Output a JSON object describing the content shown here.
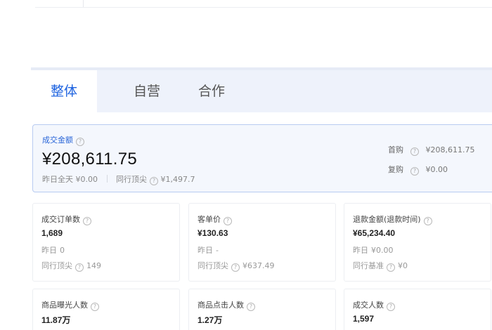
{
  "tabs": [
    {
      "label": "整体",
      "active": true
    },
    {
      "label": "自营",
      "active": false
    },
    {
      "label": "合作",
      "active": false
    }
  ],
  "hero": {
    "label": "成交金额",
    "value": "¥208,611.75",
    "yesterday_label": "昨日全天",
    "yesterday_value": "¥0.00",
    "peer_label": "同行顶尖",
    "peer_value": "¥1,497.7",
    "first_purchase_label": "首购",
    "first_purchase_value": "¥208,611.75",
    "repeat_purchase_label": "复购",
    "repeat_purchase_value": "¥0.00"
  },
  "cards": [
    {
      "title": "成交订单数",
      "value": "1,689",
      "line2_label": "昨日",
      "line2_value": "0",
      "line3_label": "同行顶尖",
      "line3_value": "149"
    },
    {
      "title": "客单价",
      "value": "¥130.63",
      "line2_label": "昨日",
      "line2_value": "-",
      "line3_label": "同行顶尖",
      "line3_value": "¥637.49"
    },
    {
      "title": "退款金额(退款时间)",
      "value": "¥65,234.40",
      "line2_label": "昨日",
      "line2_value": "¥0.00",
      "line3_label": "同行基准",
      "line3_value": "¥0"
    },
    {
      "title": "商品曝光人数",
      "value": "11.87万"
    },
    {
      "title": "商品点击人数",
      "value": "1.27万"
    },
    {
      "title": "成交人数",
      "value": "1,597"
    }
  ],
  "colors": {
    "accent": "#1f64e0",
    "tab_bg": "#eef2fb",
    "hero_bg": "#f4f7fd",
    "hero_border": "#b8cbf1"
  }
}
